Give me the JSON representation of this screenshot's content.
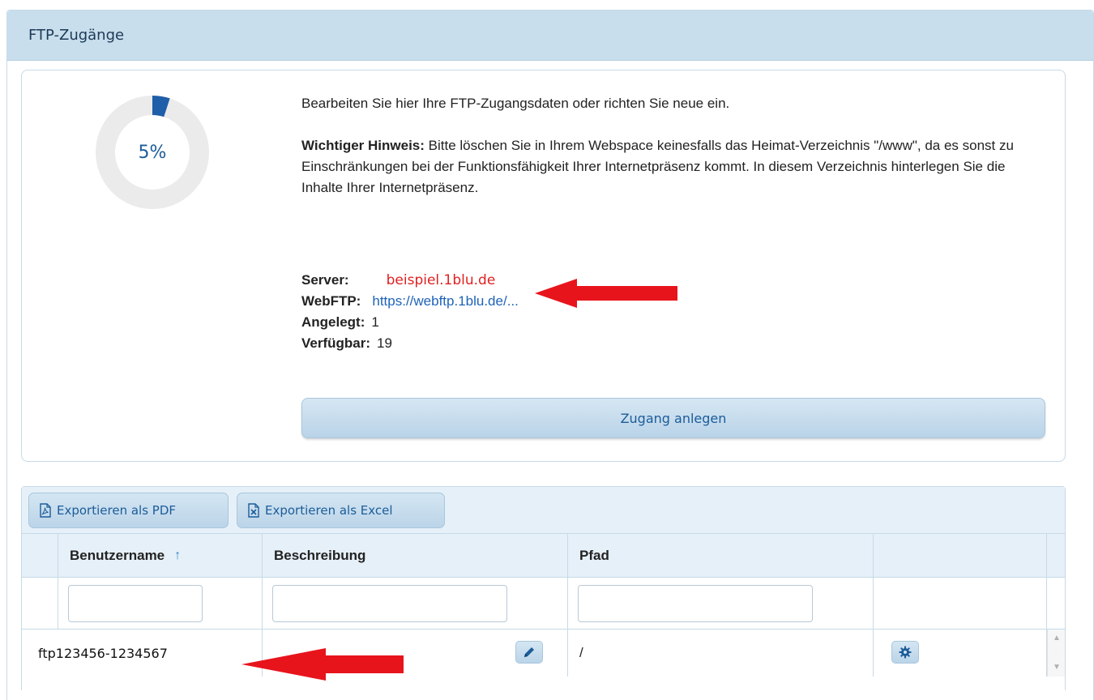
{
  "panel": {
    "title": "FTP-Zugänge"
  },
  "usage": {
    "percent": 5,
    "label": "5%"
  },
  "info": {
    "intro": "Bearbeiten Sie hier Ihre FTP-Zugangsdaten oder richten Sie neue ein.",
    "notice_label": "Wichtiger Hinweis:",
    "notice_text": " Bitte löschen Sie in Ihrem Webspace keinesfalls das Heimat-Verzeichnis \"/www\", da es sonst zu Einschränkungen bei der Funktionsfähigkeit Ihrer Internetpräsenz kommt. In diesem Verzeichnis hinterlegen Sie die Inhalte Ihrer Internetpräsenz."
  },
  "details": {
    "server_label": "Server:",
    "server_value": "beispiel.1blu.de",
    "webftp_label": "WebFTP:",
    "webftp_value": "https://webftp.1blu.de/...",
    "created_label": "Angelegt:",
    "created_value": "1",
    "available_label": "Verfügbar:",
    "available_value": "19"
  },
  "actions": {
    "create_label": "Zugang anlegen"
  },
  "toolbar": {
    "export_pdf": "Exportieren als PDF",
    "export_excel": "Exportieren als Excel"
  },
  "table": {
    "columns": {
      "username": "Benutzername",
      "description": "Beschreibung",
      "path": "Pfad"
    },
    "sort_icon": "↑",
    "rows": [
      {
        "username": "ftp123456-1234567",
        "description": "",
        "path": "/"
      }
    ]
  },
  "colors": {
    "accent": "#1c5c99",
    "header_bg": "#c8deed",
    "server_red": "#e02020",
    "annotation_arrow": "#e8141c",
    "donut_fill": "#1f5ea8",
    "donut_track": "#ebebeb"
  },
  "icons": [
    "pdf-icon",
    "excel-icon",
    "pencil-icon",
    "gear-icon",
    "sort-up-icon",
    "arrow-annotation"
  ]
}
